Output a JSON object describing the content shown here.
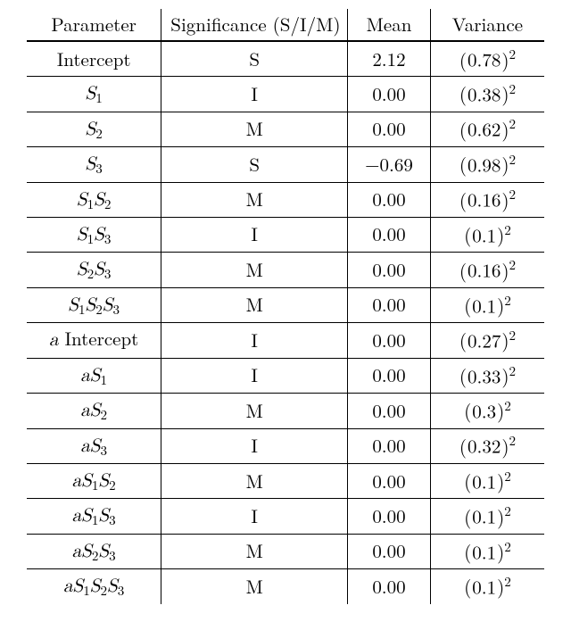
{
  "chart_data": {
    "type": "table",
    "title": "",
    "columns": [
      "Parameter",
      "Significance (S/I/M)",
      "Mean",
      "Variance"
    ],
    "rows": [
      {
        "parameter": "Intercept",
        "significance": "S",
        "mean": 2.12,
        "variance_base": 0.78
      },
      {
        "parameter": "S1",
        "significance": "I",
        "mean": 0.0,
        "variance_base": 0.38
      },
      {
        "parameter": "S2",
        "significance": "M",
        "mean": 0.0,
        "variance_base": 0.62
      },
      {
        "parameter": "S3",
        "significance": "S",
        "mean": -0.69,
        "variance_base": 0.98
      },
      {
        "parameter": "S1S2",
        "significance": "M",
        "mean": 0.0,
        "variance_base": 0.16
      },
      {
        "parameter": "S1S3",
        "significance": "I",
        "mean": 0.0,
        "variance_base": 0.1
      },
      {
        "parameter": "S2S3",
        "significance": "M",
        "mean": 0.0,
        "variance_base": 0.16
      },
      {
        "parameter": "S1S2S3",
        "significance": "M",
        "mean": 0.0,
        "variance_base": 0.1
      },
      {
        "parameter": "a Intercept",
        "significance": "I",
        "mean": 0.0,
        "variance_base": 0.27
      },
      {
        "parameter": "aS1",
        "significance": "I",
        "mean": 0.0,
        "variance_base": 0.33
      },
      {
        "parameter": "aS2",
        "significance": "M",
        "mean": 0.0,
        "variance_base": 0.3
      },
      {
        "parameter": "aS3",
        "significance": "I",
        "mean": 0.0,
        "variance_base": 0.32
      },
      {
        "parameter": "aS1S2",
        "significance": "M",
        "mean": 0.0,
        "variance_base": 0.1
      },
      {
        "parameter": "aS1S3",
        "significance": "I",
        "mean": 0.0,
        "variance_base": 0.1
      },
      {
        "parameter": "aS2S3",
        "significance": "M",
        "mean": 0.0,
        "variance_base": 0.1
      },
      {
        "parameter": "aS1S2S3",
        "significance": "M",
        "mean": 0.0,
        "variance_base": 0.1
      }
    ]
  },
  "headers": {
    "parameter": "Parameter",
    "significance": "Significance (S/I/M)",
    "mean": "Mean",
    "variance": "Variance"
  },
  "labels": {
    "intercept": "Intercept",
    "a_intercept_prefix": "a",
    "a_intercept_word": " Intercept"
  },
  "symbols": {
    "S": "S",
    "a": "a",
    "sub1": "1",
    "sub2": "2",
    "sub3": "3"
  },
  "cells": {
    "sig": [
      "S",
      "I",
      "M",
      "S",
      "M",
      "I",
      "M",
      "M",
      "I",
      "I",
      "M",
      "I",
      "M",
      "I",
      "M",
      "M"
    ],
    "mean_pos": [
      "2.12",
      "0.00",
      "0.00",
      "0.69",
      "0.00",
      "0.00",
      "0.00",
      "0.00",
      "0.00",
      "0.00",
      "0.00",
      "0.00",
      "0.00",
      "0.00",
      "0.00",
      "0.00"
    ],
    "mean_neg": [
      false,
      false,
      false,
      true,
      false,
      false,
      false,
      false,
      false,
      false,
      false,
      false,
      false,
      false,
      false,
      false
    ],
    "var": [
      "0.78",
      "0.38",
      "0.62",
      "0.98",
      "0.16",
      "0.1",
      "0.16",
      "0.1",
      "0.27",
      "0.33",
      "0.3",
      "0.32",
      "0.1",
      "0.1",
      "0.1",
      "0.1"
    ]
  }
}
